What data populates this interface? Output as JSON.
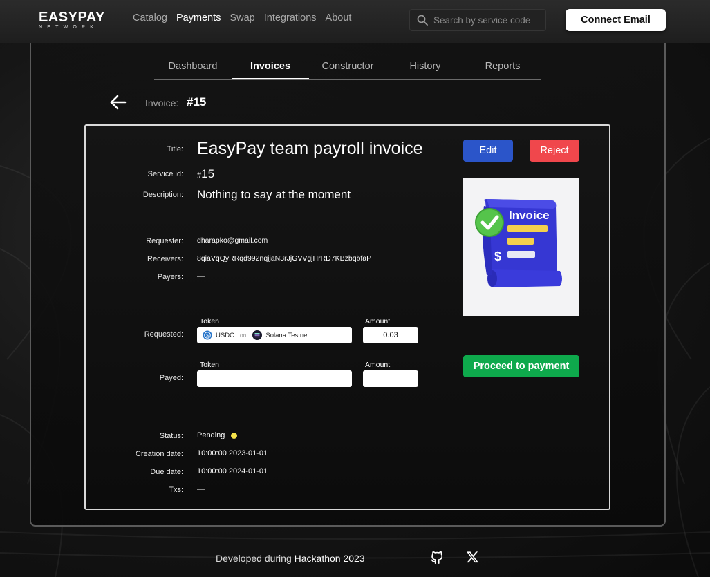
{
  "logo": {
    "main": "EASYPAY",
    "sub": "NETWORK"
  },
  "nav": {
    "items": [
      {
        "label": "Catalog"
      },
      {
        "label": "Payments"
      },
      {
        "label": "Swap"
      },
      {
        "label": "Integrations"
      },
      {
        "label": "About"
      }
    ],
    "active": "Payments"
  },
  "search": {
    "placeholder": "Search by service code",
    "icon": "search-icon"
  },
  "connect_label": "Connect Email",
  "tabs": [
    {
      "label": "Dashboard"
    },
    {
      "label": "Invoices"
    },
    {
      "label": "Constructor"
    },
    {
      "label": "History"
    },
    {
      "label": "Reports"
    }
  ],
  "active_tab": "Invoices",
  "invoice_header": {
    "label": "Invoice:",
    "number": "#15"
  },
  "invoice": {
    "title_label": "Title:",
    "title": "EasyPay team payroll invoice",
    "service_label": "Service id:",
    "service_hash": "#",
    "service_id": "15",
    "description_label": "Description:",
    "description": "Nothing to say at the moment",
    "requester_label": "Requester:",
    "requester": "dharapko@gmail.com",
    "receivers_label": "Receivers:",
    "receivers": "8qiaVqQyRRqd992nqjjaN3rJjGVVgjHrRD7KBzbqbfaP",
    "payers_label": "Payers:",
    "payers": "—",
    "requested_label": "Requested:",
    "payed_label": "Payed:",
    "token_head": "Token",
    "amount_head": "Amount",
    "requested_token": "USDC",
    "requested_on": "on",
    "requested_network": "Solana Testnet",
    "requested_amount": "0.03",
    "payed_token": "",
    "payed_amount": "",
    "status_label": "Status:",
    "status": "Pending",
    "creation_label": "Creation date:",
    "creation_date": "10:00:00 2023-01-01",
    "due_label": "Due date:",
    "due_date": "10:00:00 2024-01-01",
    "txs_label": "Txs:",
    "txs": "—"
  },
  "image": {
    "caption": "Invoice",
    "icon": "invoice-illustration"
  },
  "actions": {
    "edit": "Edit",
    "reject": "Reject",
    "proceed": "Proceed to payment"
  },
  "colors": {
    "edit": "#2b55c9",
    "reject": "#f0474c",
    "proceed": "#0ea94c",
    "pending": "#f5e34a"
  },
  "footer": {
    "prefix": "Developed during",
    "event": "Hackathon 2023",
    "icons": [
      "github-icon",
      "x-icon"
    ]
  }
}
